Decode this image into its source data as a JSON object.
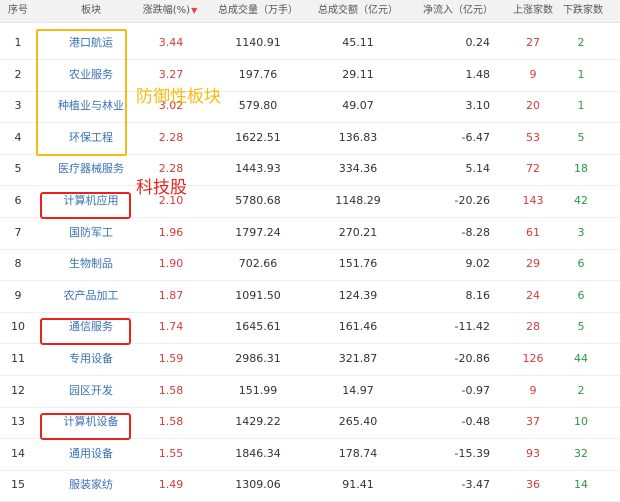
{
  "header": {
    "no": "序号",
    "name": "板块",
    "change": "涨跌幅(%)",
    "sort_arrow": "▼",
    "volume": "总成交量（万手）",
    "amount": "总成交额（亿元）",
    "netflow": "净流入（亿元）",
    "up": "上涨家数",
    "down": "下跌家数"
  },
  "rows": [
    {
      "no": "1",
      "name": "港口航运",
      "change": "3.44",
      "volume": "1140.91",
      "amount": "45.11",
      "netflow": "0.24",
      "up": "27",
      "down": "2"
    },
    {
      "no": "2",
      "name": "农业服务",
      "change": "3.27",
      "volume": "197.76",
      "amount": "29.11",
      "netflow": "1.48",
      "up": "9",
      "down": "1"
    },
    {
      "no": "3",
      "name": "种植业与林业",
      "change": "3.02",
      "volume": "579.80",
      "amount": "49.07",
      "netflow": "3.10",
      "up": "20",
      "down": "1"
    },
    {
      "no": "4",
      "name": "环保工程",
      "change": "2.28",
      "volume": "1622.51",
      "amount": "136.83",
      "netflow": "-6.47",
      "up": "53",
      "down": "5"
    },
    {
      "no": "5",
      "name": "医疗器械服务",
      "change": "2.28",
      "volume": "1443.93",
      "amount": "334.36",
      "netflow": "5.14",
      "up": "72",
      "down": "18"
    },
    {
      "no": "6",
      "name": "计算机应用",
      "change": "2.10",
      "volume": "5780.68",
      "amount": "1148.29",
      "netflow": "-20.26",
      "up": "143",
      "down": "42"
    },
    {
      "no": "7",
      "name": "国防军工",
      "change": "1.96",
      "volume": "1797.24",
      "amount": "270.21",
      "netflow": "-8.28",
      "up": "61",
      "down": "3"
    },
    {
      "no": "8",
      "name": "生物制品",
      "change": "1.90",
      "volume": "702.66",
      "amount": "151.76",
      "netflow": "9.02",
      "up": "29",
      "down": "6"
    },
    {
      "no": "9",
      "name": "农产品加工",
      "change": "1.87",
      "volume": "1091.50",
      "amount": "124.39",
      "netflow": "8.16",
      "up": "24",
      "down": "6"
    },
    {
      "no": "10",
      "name": "通信服务",
      "change": "1.74",
      "volume": "1645.61",
      "amount": "161.46",
      "netflow": "-11.42",
      "up": "28",
      "down": "5"
    },
    {
      "no": "11",
      "name": "专用设备",
      "change": "1.59",
      "volume": "2986.31",
      "amount": "321.87",
      "netflow": "-20.86",
      "up": "126",
      "down": "44"
    },
    {
      "no": "12",
      "name": "园区开发",
      "change": "1.58",
      "volume": "151.99",
      "amount": "14.97",
      "netflow": "-0.97",
      "up": "9",
      "down": "2"
    },
    {
      "no": "13",
      "name": "计算机设备",
      "change": "1.58",
      "volume": "1429.22",
      "amount": "265.40",
      "netflow": "-0.48",
      "up": "37",
      "down": "10"
    },
    {
      "no": "14",
      "name": "通用设备",
      "change": "1.55",
      "volume": "1846.34",
      "amount": "178.74",
      "netflow": "-15.39",
      "up": "93",
      "down": "32"
    },
    {
      "no": "15",
      "name": "服装家纺",
      "change": "1.49",
      "volume": "1309.06",
      "amount": "91.41",
      "netflow": "-3.47",
      "up": "36",
      "down": "14"
    }
  ],
  "annotations": {
    "defensive": "防御性板块",
    "tech": "科技股"
  },
  "colors": {
    "positive": "#d13c3c",
    "negative": "#2a9a4a",
    "link": "#3973b6",
    "highlight_yellow": "#f5bb12",
    "highlight_red": "#e8231d"
  }
}
